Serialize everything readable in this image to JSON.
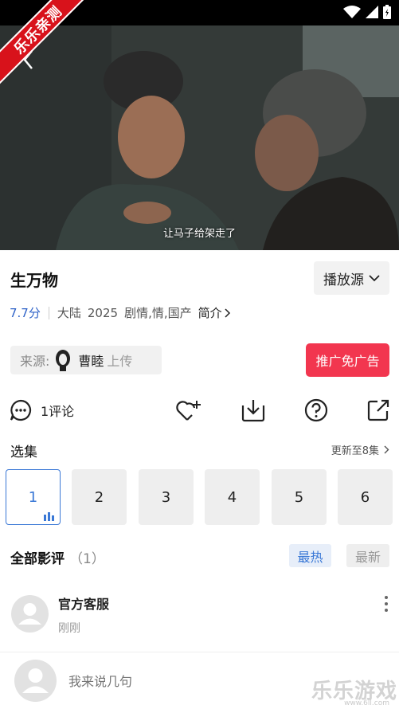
{
  "ribbon": {
    "text": "乐乐亲测"
  },
  "video": {
    "subtitle": "让马子给架走了"
  },
  "movie": {
    "title": "生万物",
    "source_button": "播放源",
    "rating": "7.7分",
    "region": "大陆",
    "year": "2025",
    "genres": "剧情,情,国产",
    "intro_label": "简介"
  },
  "uploader": {
    "label": "来源:",
    "name": "曹睦",
    "suffix": "上传"
  },
  "promo": {
    "label": "推广免广告"
  },
  "actions": {
    "comment_label": "1评论"
  },
  "episodes": {
    "title": "选集",
    "update": "更新至8集",
    "items": [
      "1",
      "2",
      "3",
      "4",
      "5",
      "6"
    ],
    "active": "1"
  },
  "reviews": {
    "title": "全部影评",
    "count": "（1）",
    "tab_hot": "最热",
    "tab_new": "最新",
    "items": [
      {
        "author": "官方客服",
        "time": "刚刚"
      }
    ]
  },
  "composer": {
    "placeholder": "我来说几句"
  },
  "watermark": {
    "text": "乐乐游戏",
    "url": "www.6ll.com"
  },
  "colors": {
    "accent": "#3a78d6",
    "promo": "#f2364f",
    "rating": "#2f63c8"
  }
}
